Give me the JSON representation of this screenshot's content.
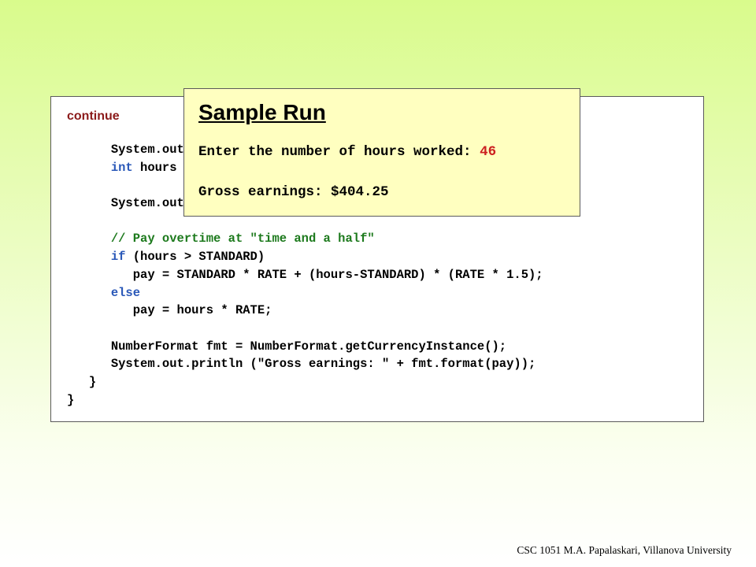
{
  "slide": {
    "continue_label": "continue",
    "code_lines": [
      {
        "indent": "      ",
        "parts": [
          {
            "t": "System.out.print (\"Enter the number of hours worked: \");",
            "c": ""
          }
        ]
      },
      {
        "indent": "      ",
        "parts": [
          {
            "t": "int",
            "c": "kw"
          },
          {
            "t": " hours = scan.nextInt();",
            "c": ""
          }
        ]
      },
      {
        "indent": "",
        "parts": []
      },
      {
        "indent": "      ",
        "parts": [
          {
            "t": "System.out.println ();",
            "c": ""
          }
        ]
      },
      {
        "indent": "",
        "parts": []
      },
      {
        "indent": "      ",
        "parts": [
          {
            "t": "// Pay overtime at \"time and a half\"",
            "c": "cm"
          }
        ]
      },
      {
        "indent": "      ",
        "parts": [
          {
            "t": "if",
            "c": "kw"
          },
          {
            "t": " (hours > STANDARD)",
            "c": ""
          }
        ]
      },
      {
        "indent": "         ",
        "parts": [
          {
            "t": "pay = STANDARD * RATE + (hours-STANDARD) * (RATE * 1.5);",
            "c": ""
          }
        ]
      },
      {
        "indent": "      ",
        "parts": [
          {
            "t": "else",
            "c": "kw"
          }
        ]
      },
      {
        "indent": "         ",
        "parts": [
          {
            "t": "pay = hours * RATE;",
            "c": ""
          }
        ]
      },
      {
        "indent": "",
        "parts": []
      },
      {
        "indent": "      ",
        "parts": [
          {
            "t": "NumberFormat fmt = NumberFormat.getCurrencyInstance();",
            "c": ""
          }
        ]
      },
      {
        "indent": "      ",
        "parts": [
          {
            "t": "System.out.println (\"Gross earnings: \" + fmt.format(pay));",
            "c": ""
          }
        ]
      },
      {
        "indent": "   ",
        "parts": [
          {
            "t": "}",
            "c": ""
          }
        ]
      },
      {
        "indent": "",
        "parts": [
          {
            "t": "}",
            "c": ""
          }
        ]
      }
    ],
    "colors": {
      "keyword": "#2a58b8",
      "comment": "#1d7a1d",
      "continue_label": "#8b1a1a",
      "popup_background": "#ffffc0",
      "input_value": "#cc2020"
    }
  },
  "sample_run": {
    "title": "Sample Run",
    "prompt": "Enter the number of hours worked: ",
    "input": "46",
    "output": "Gross earnings: $404.25"
  },
  "footer": {
    "text": "CSC 1051 M.A. Papalaskari, Villanova University"
  }
}
